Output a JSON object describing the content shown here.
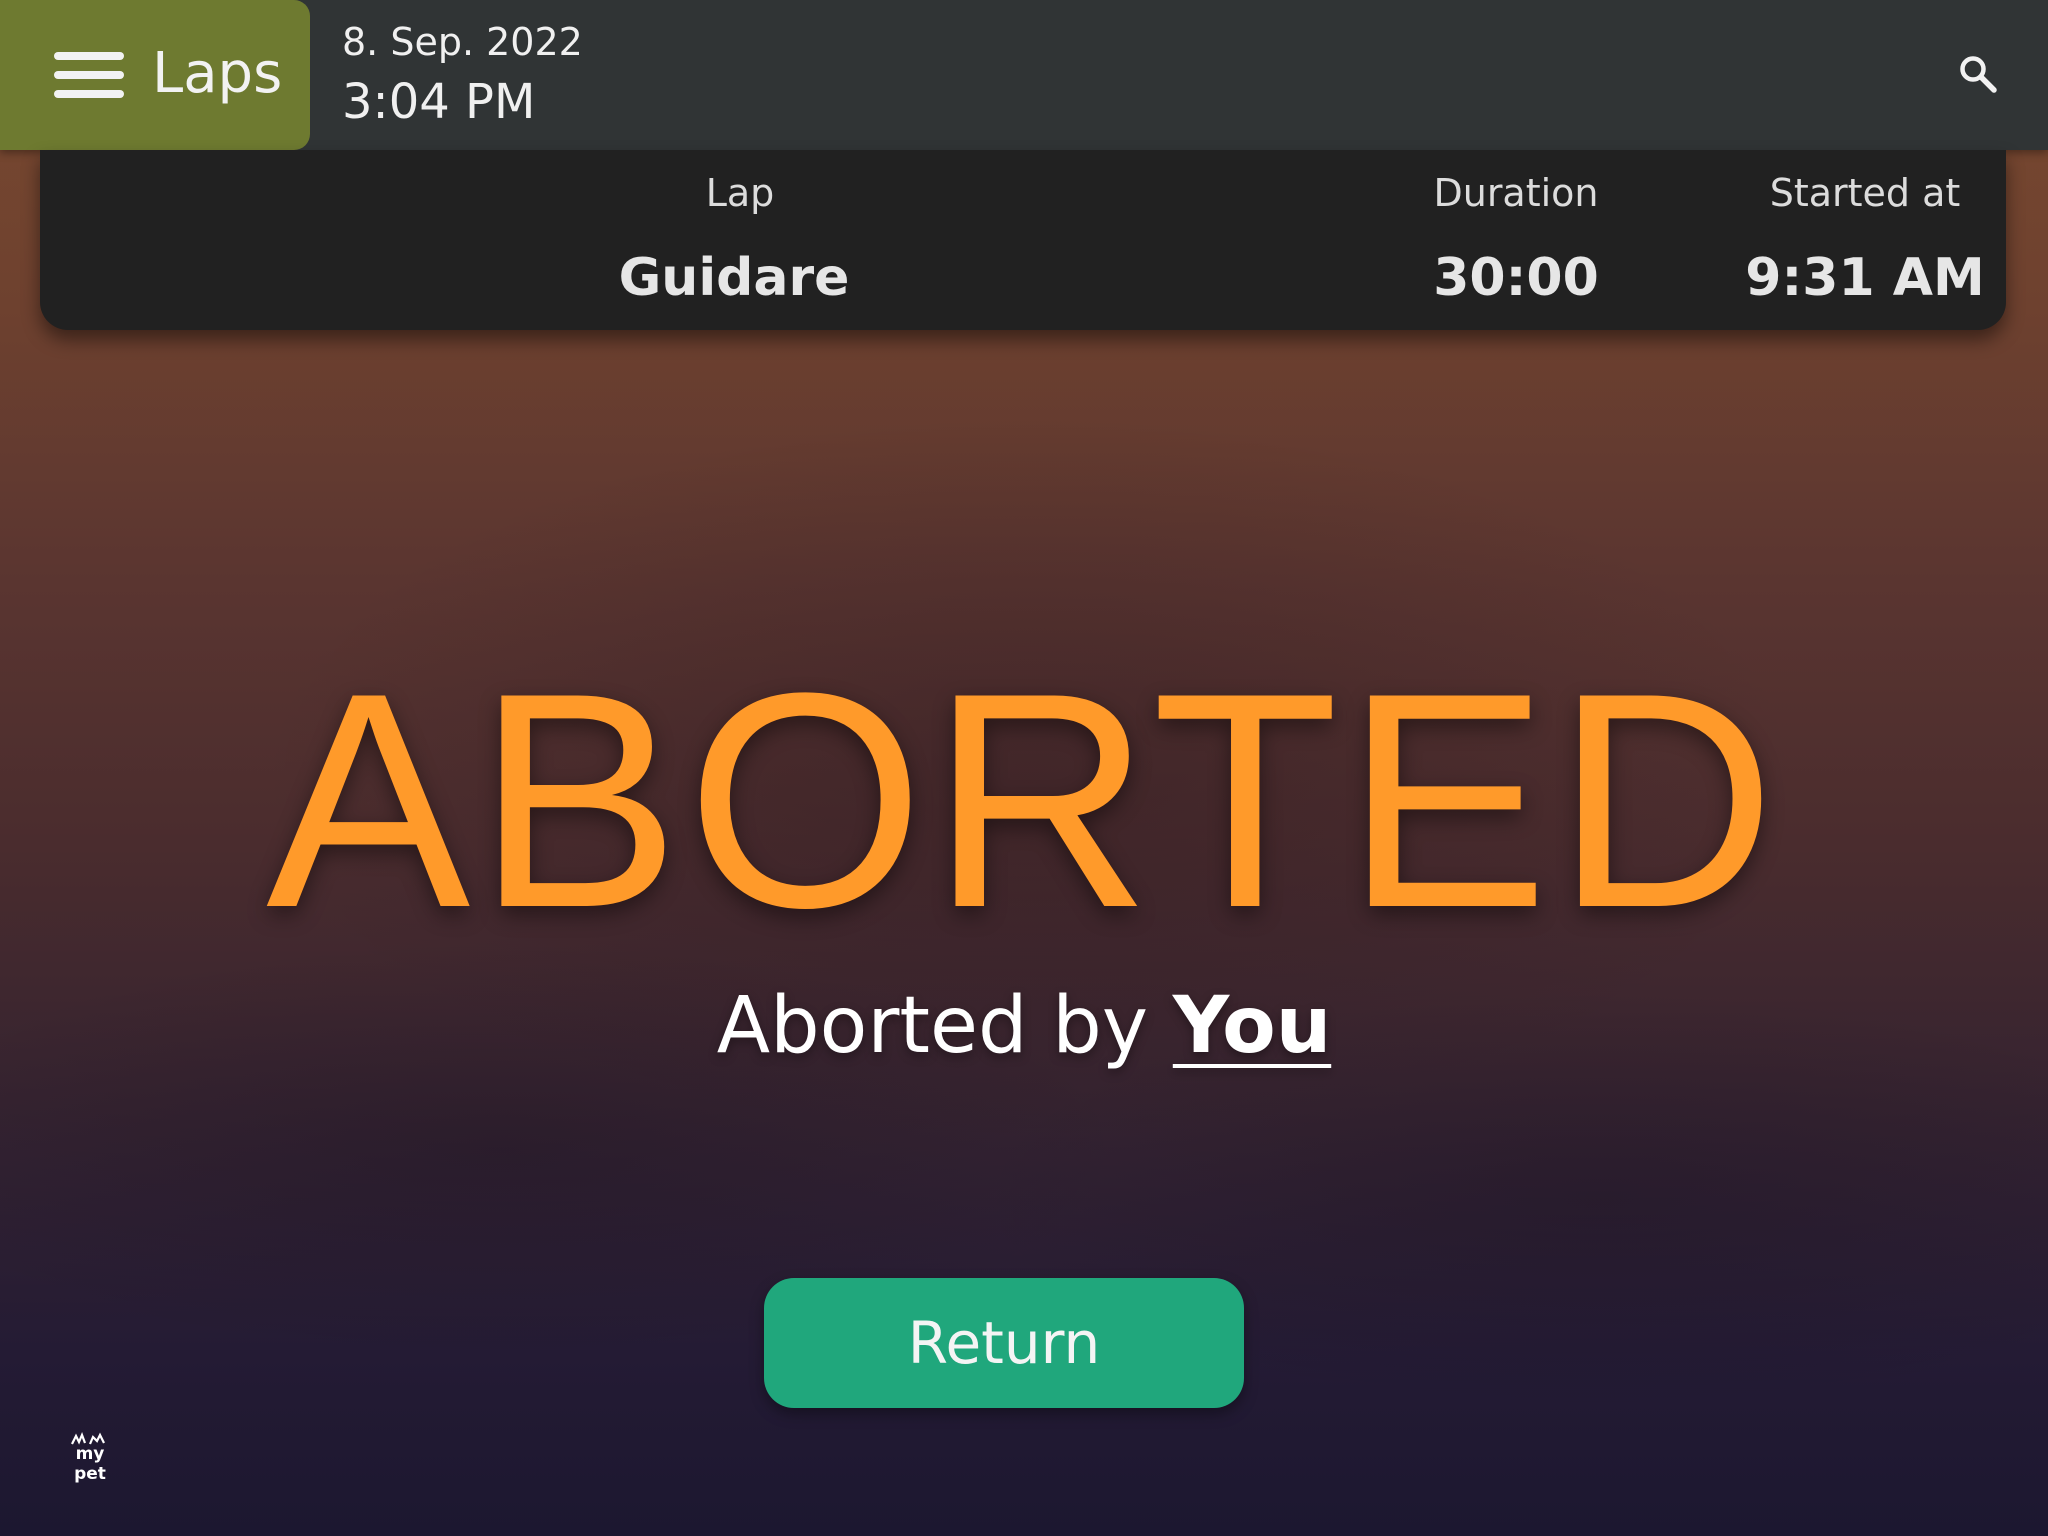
{
  "header": {
    "app_title": "Laps",
    "date": "8. Sep. 2022",
    "time": "3:04 PM",
    "nav_color": "#6e7a30",
    "bar_color": "#303435"
  },
  "lap_info": {
    "columns": [
      {
        "header": "Lap",
        "value": "Guidare"
      },
      {
        "header": "Duration",
        "value": "30:00"
      },
      {
        "header": "Started at",
        "value": "9:31 AM"
      }
    ]
  },
  "status": {
    "title": "ABORTED",
    "subtitle_prefix": "Aborted by",
    "subtitle_user": "You",
    "title_color": "#ff9a2a"
  },
  "actions": {
    "return_label": "Return",
    "return_color": "#20a77c"
  },
  "footer": {
    "logo_text": "my pet"
  },
  "icons": {
    "menu": "hamburger-menu-icon",
    "search": "search-icon"
  }
}
